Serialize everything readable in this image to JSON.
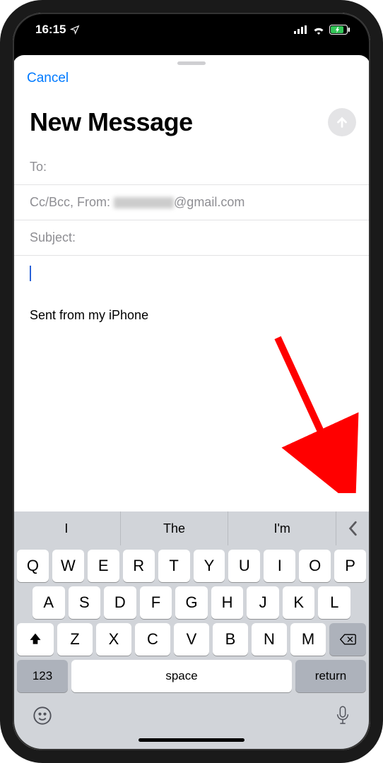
{
  "status": {
    "time": "16:15"
  },
  "compose": {
    "cancel": "Cancel",
    "title": "New Message",
    "to_label": "To:",
    "ccbcc_from_label": "Cc/Bcc, From:",
    "from_domain": "@gmail.com",
    "subject_label": "Subject:",
    "signature": "Sent from my iPhone"
  },
  "keyboard": {
    "suggestions": [
      "I",
      "The",
      "I'm"
    ],
    "row1": [
      "Q",
      "W",
      "E",
      "R",
      "T",
      "Y",
      "U",
      "I",
      "O",
      "P"
    ],
    "row2": [
      "A",
      "S",
      "D",
      "F",
      "G",
      "H",
      "J",
      "K",
      "L"
    ],
    "row3": [
      "Z",
      "X",
      "C",
      "V",
      "B",
      "N",
      "M"
    ],
    "numbers_key": "123",
    "space_key": "space",
    "return_key": "return"
  }
}
